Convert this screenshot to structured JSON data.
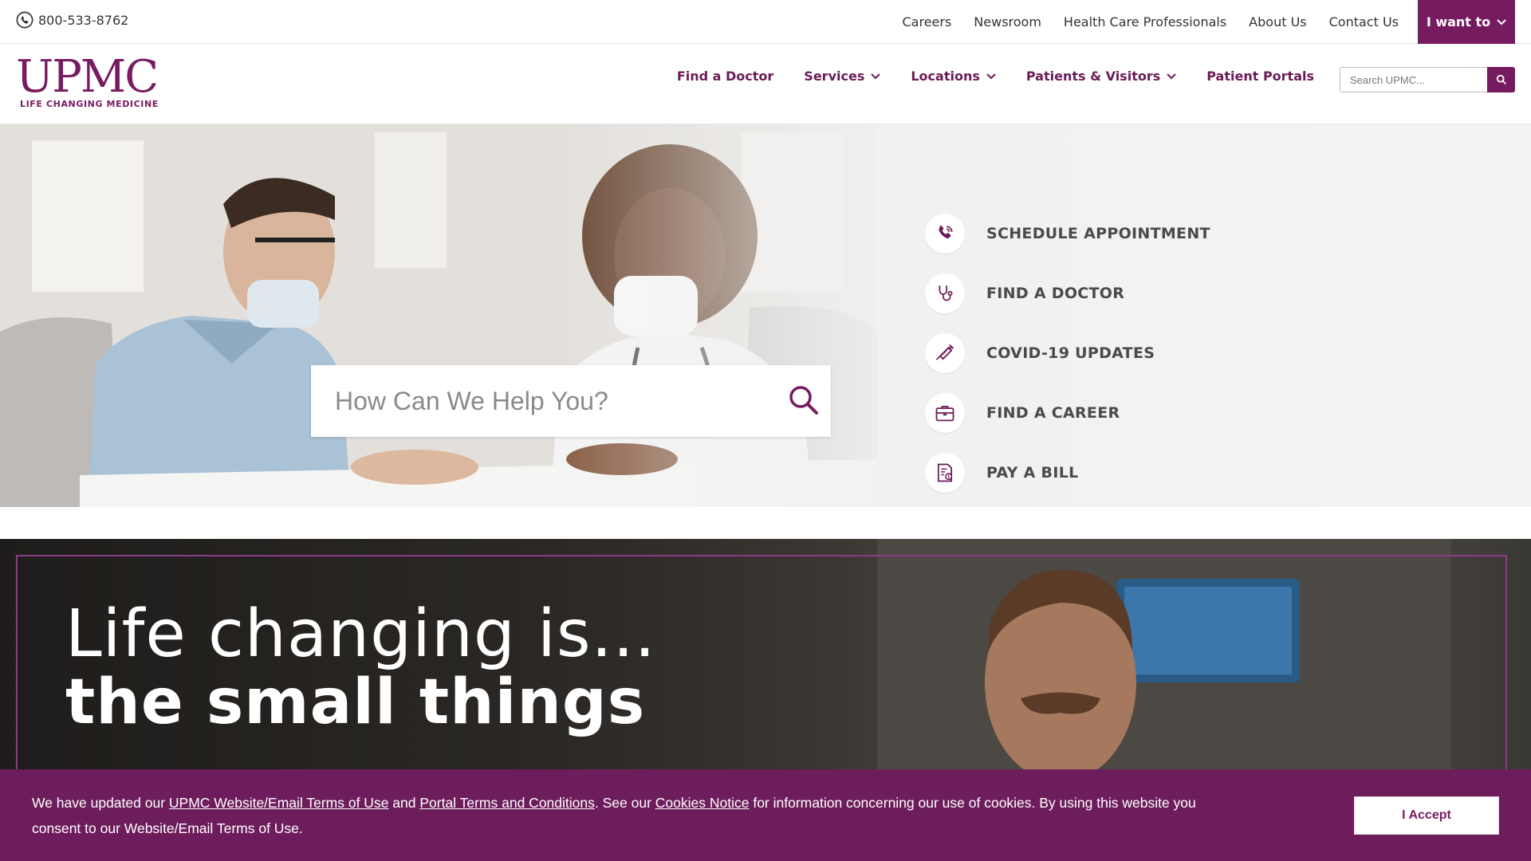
{
  "utility": {
    "phone": "800-533-8762",
    "links": [
      "Careers",
      "Newsroom",
      "Health Care Professionals",
      "About Us",
      "Contact Us"
    ],
    "i_want_to": "I want to"
  },
  "logo": {
    "mark": "UPMC",
    "tagline": "LIFE CHANGING MEDICINE"
  },
  "nav": {
    "items": [
      {
        "label": "Find a Doctor",
        "dropdown": false
      },
      {
        "label": "Services",
        "dropdown": true
      },
      {
        "label": "Locations",
        "dropdown": true
      },
      {
        "label": "Patients & Visitors",
        "dropdown": true
      },
      {
        "label": "Patient Portals",
        "dropdown": false
      }
    ],
    "search_placeholder": "Search UPMC..."
  },
  "hero": {
    "search_placeholder": "How Can We Help You?",
    "quick_links": [
      {
        "label": "SCHEDULE APPOINTMENT",
        "icon": "phone-icon"
      },
      {
        "label": "FIND A DOCTOR",
        "icon": "stethoscope-icon"
      },
      {
        "label": "COVID-19 UPDATES",
        "icon": "syringe-icon"
      },
      {
        "label": "FIND A CAREER",
        "icon": "briefcase-icon"
      },
      {
        "label": "PAY A BILL",
        "icon": "bill-icon"
      }
    ]
  },
  "banner": {
    "line1": "Life changing is...",
    "line2": "the small things"
  },
  "cookie": {
    "t1": "We have updated our ",
    "link1": "UPMC Website/Email Terms of Use",
    "t2": " and ",
    "link2": "Portal Terms and Conditions",
    "t3": ". See our ",
    "link3": "Cookies Notice",
    "t4": " for information concerning our use of cookies. By using this website you consent to our Website/Email Terms of Use.",
    "accept": "I Accept"
  },
  "colors": {
    "brand": "#771b61",
    "cookie_bg": "#6d1d5c",
    "frame": "#8a3a8a"
  }
}
